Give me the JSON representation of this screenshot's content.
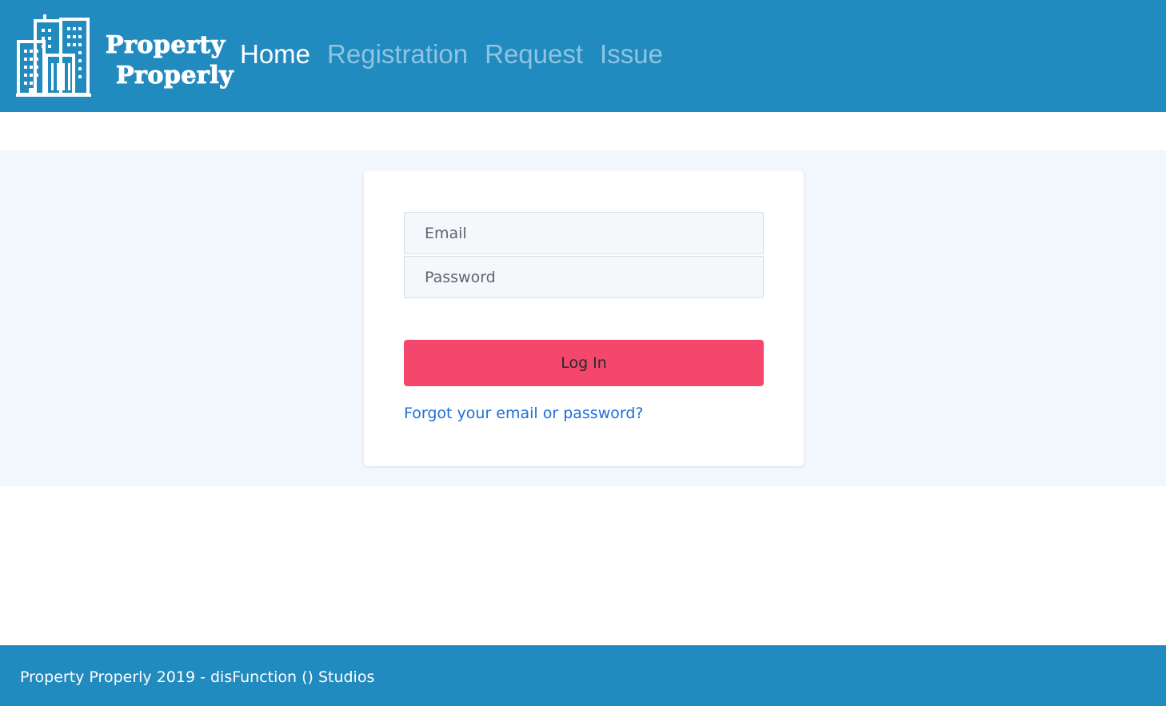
{
  "brand": {
    "line1": "Property",
    "line2": "Properly",
    "logo_icon": "city-buildings-icon"
  },
  "nav": {
    "items": [
      {
        "label": "Home",
        "active": true
      },
      {
        "label": "Registration",
        "active": false
      },
      {
        "label": "Request",
        "active": false
      },
      {
        "label": "Issue",
        "active": false
      }
    ]
  },
  "login": {
    "email_placeholder": "Email",
    "password_placeholder": "Password",
    "submit_label": "Log In",
    "forgot_link": "Forgot your email or password?"
  },
  "footer": {
    "text": "Property Properly 2019 - disFunction () Studios"
  },
  "colors": {
    "header_bg": "#218abe",
    "nav_active": "#ffffff",
    "nav_inactive": "#8cc4e2",
    "band_bg": "#f2f7fe",
    "button_bg": "#f4476b",
    "link": "#1d6fd8"
  }
}
